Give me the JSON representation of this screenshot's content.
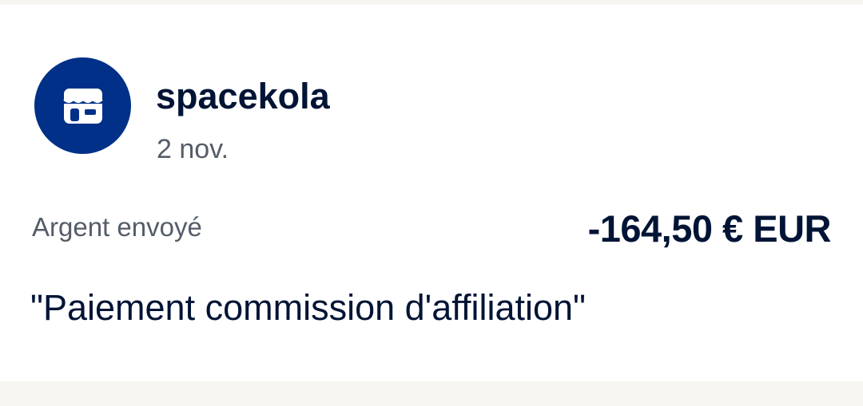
{
  "transaction": {
    "merchant_name": "spacekola",
    "date": "2 nov.",
    "type_label": "Argent envoyé",
    "amount": "-164,50 € EUR",
    "note": "\"Paiement commission d'affiliation\""
  },
  "icons": {
    "avatar": "store-icon"
  },
  "colors": {
    "avatar_bg": "#003087",
    "primary_text": "#001435",
    "secondary_text": "#545d68",
    "card_bg": "#ffffff",
    "page_bg": "#f6f5f2"
  }
}
